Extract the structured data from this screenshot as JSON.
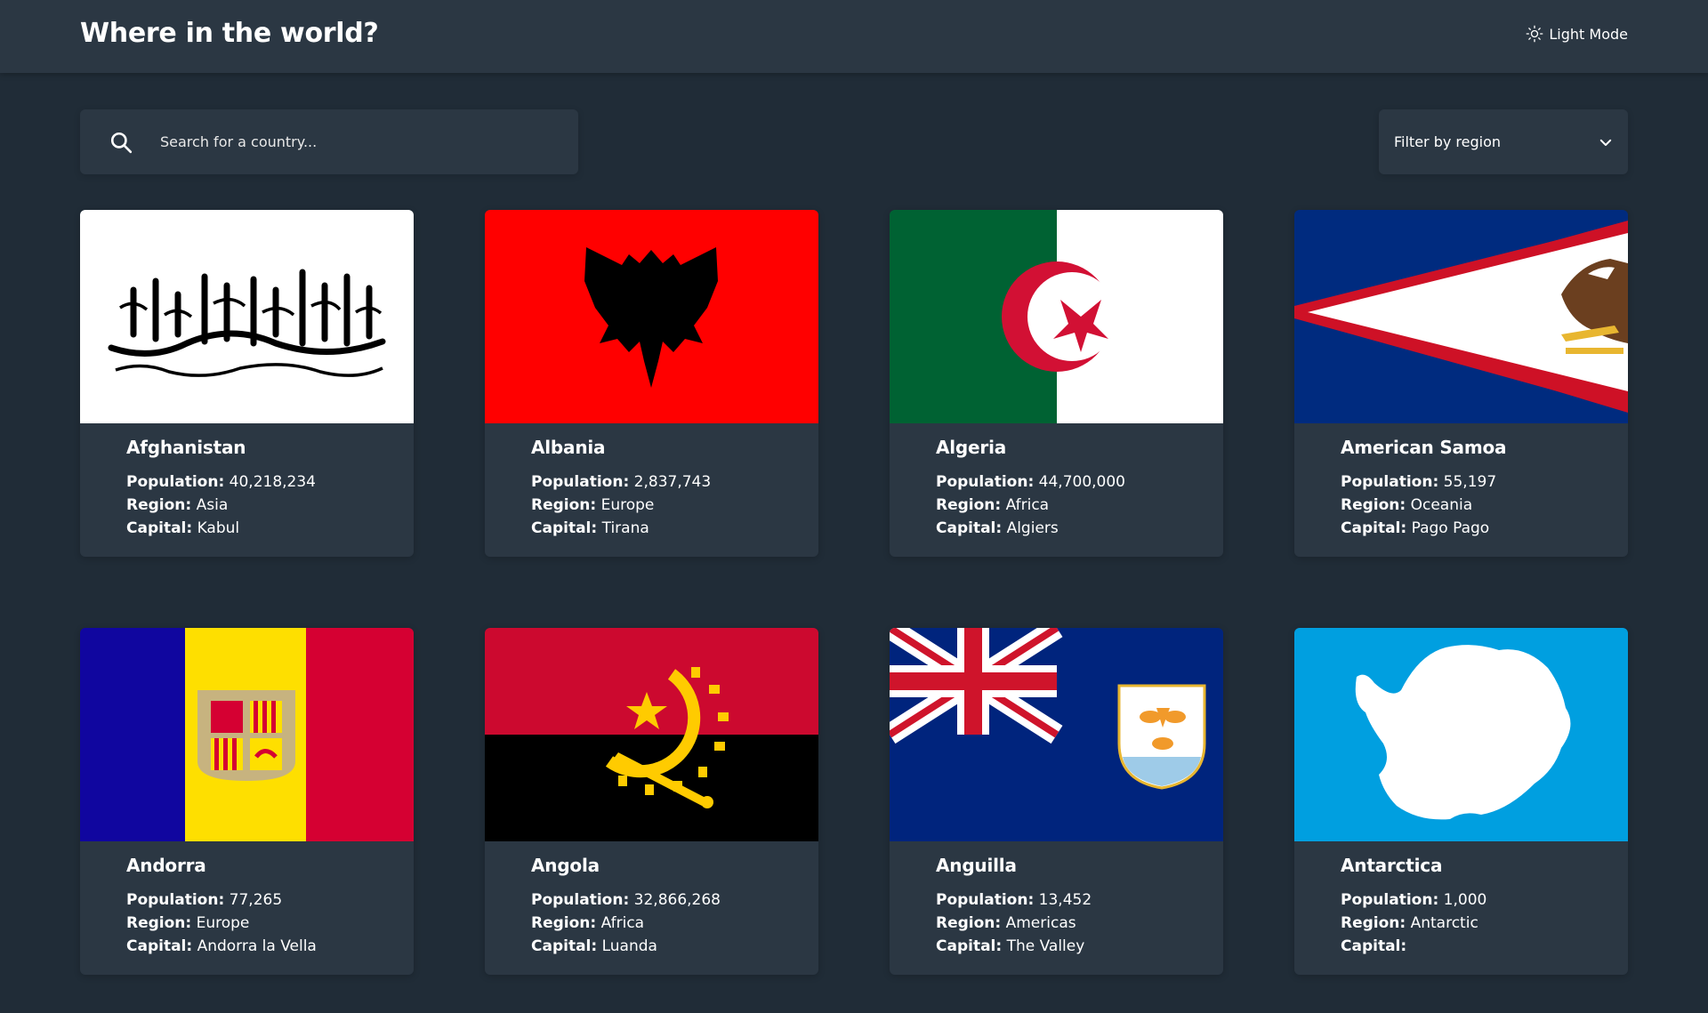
{
  "header": {
    "title": "Where in the world?",
    "theme_toggle_label": "Light Mode"
  },
  "search": {
    "placeholder": "Search for a country...",
    "value": ""
  },
  "filter": {
    "label": "Filter by region"
  },
  "labels": {
    "population": "Population:",
    "region": "Region:",
    "capital": "Capital:"
  },
  "countries": [
    {
      "name": "Afghanistan",
      "population": "40,218,234",
      "region": "Asia",
      "capital": "Kabul",
      "flag_icon": "flag-afghanistan-icon"
    },
    {
      "name": "Albania",
      "population": "2,837,743",
      "region": "Europe",
      "capital": "Tirana",
      "flag_icon": "flag-albania-icon"
    },
    {
      "name": "Algeria",
      "population": "44,700,000",
      "region": "Africa",
      "capital": "Algiers",
      "flag_icon": "flag-algeria-icon"
    },
    {
      "name": "American Samoa",
      "population": "55,197",
      "region": "Oceania",
      "capital": "Pago Pago",
      "flag_icon": "flag-american-samoa-icon"
    },
    {
      "name": "Andorra",
      "population": "77,265",
      "region": "Europe",
      "capital": "Andorra la Vella",
      "flag_icon": "flag-andorra-icon"
    },
    {
      "name": "Angola",
      "population": "32,866,268",
      "region": "Africa",
      "capital": "Luanda",
      "flag_icon": "flag-angola-icon"
    },
    {
      "name": "Anguilla",
      "population": "13,452",
      "region": "Americas",
      "capital": "The Valley",
      "flag_icon": "flag-anguilla-icon"
    },
    {
      "name": "Antarctica",
      "population": "1,000",
      "region": "Antarctic",
      "capital": "",
      "flag_icon": "flag-antarctica-icon"
    }
  ],
  "colors": {
    "background": "#202c37",
    "element": "#2b3743",
    "text": "#ffffff"
  }
}
